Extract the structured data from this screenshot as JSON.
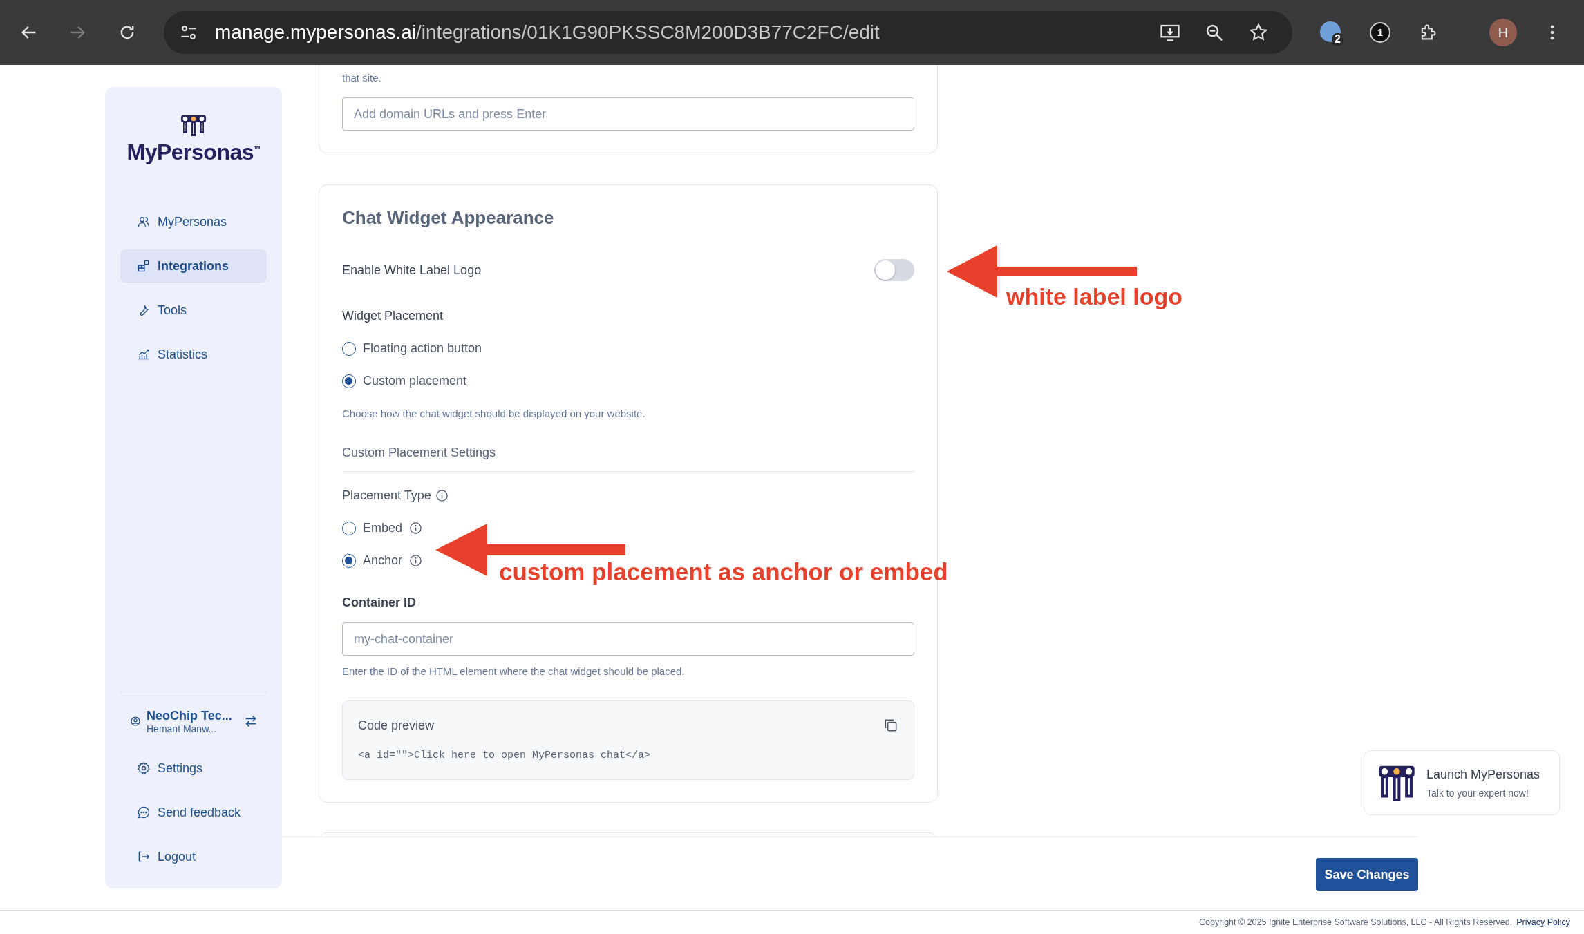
{
  "browser": {
    "url_host": "manage.mypersonas.ai",
    "url_path": "/integrations/01K1G90PKSSC8M200D3B77C2FC/edit",
    "extension_badge": "2",
    "extension_count": "1",
    "profile_initial": "H"
  },
  "sidebar": {
    "logo": "MyPersonas$^{™}$",
    "nav": [
      {
        "label": "MyPersonas",
        "selected": false
      },
      {
        "label": "Integrations",
        "selected": true
      },
      {
        "label": "Tools",
        "selected": false
      },
      {
        "label": "Statistics",
        "selected": false
      }
    ],
    "account": {
      "name": "NeoChip Tec...",
      "user": "Hemant Manw..."
    },
    "footer_items": [
      {
        "label": "Settings"
      },
      {
        "label": "Send feedback"
      },
      {
        "label": "Logout"
      }
    ]
  },
  "previous_card": {
    "text": "that site.",
    "domain_field": {
      "placeholder": "Add domain URLs and press Enter"
    }
  },
  "appearance": {
    "title": "Chat Widget Appearance",
    "white_label": {
      "label": "Enable White Label Logo",
      "on": false
    },
    "widget_placement": {
      "label": "Widget Placement",
      "options": [
        {
          "label": "Floating action button",
          "selected": false
        },
        {
          "label": "Custom placement",
          "selected": true
        }
      ],
      "hint": "Choose how the chat widget should be displayed on your website."
    },
    "custom_settings_title": "Custom Placement Settings",
    "placement_type": {
      "label": "Placement Type",
      "options": [
        {
          "label": "Embed",
          "selected": false
        },
        {
          "label": "Anchor",
          "selected": true
        }
      ]
    },
    "container_id": {
      "label": "Container ID",
      "placeholder": "my-chat-container",
      "hint": "Enter the ID of the HTML element where the chat widget should be placed."
    },
    "code_preview": {
      "title": "Code preview",
      "code": "<a id=\"\">Click here to open MyPersonas chat</a>"
    }
  },
  "save_button": "Save Changes",
  "launcher": {
    "title": "Launch MyPersonas",
    "subtitle": "Talk to your expert now!"
  },
  "footer": {
    "copyright": "Copyright © 2025 Ignite Enterprise Software Solutions, LLC - All Rights Reserved.",
    "link": "Privacy Policy"
  },
  "annotations": [
    {
      "text": "white label logo"
    },
    {
      "text": "custom placement as anchor or embed"
    }
  ]
}
